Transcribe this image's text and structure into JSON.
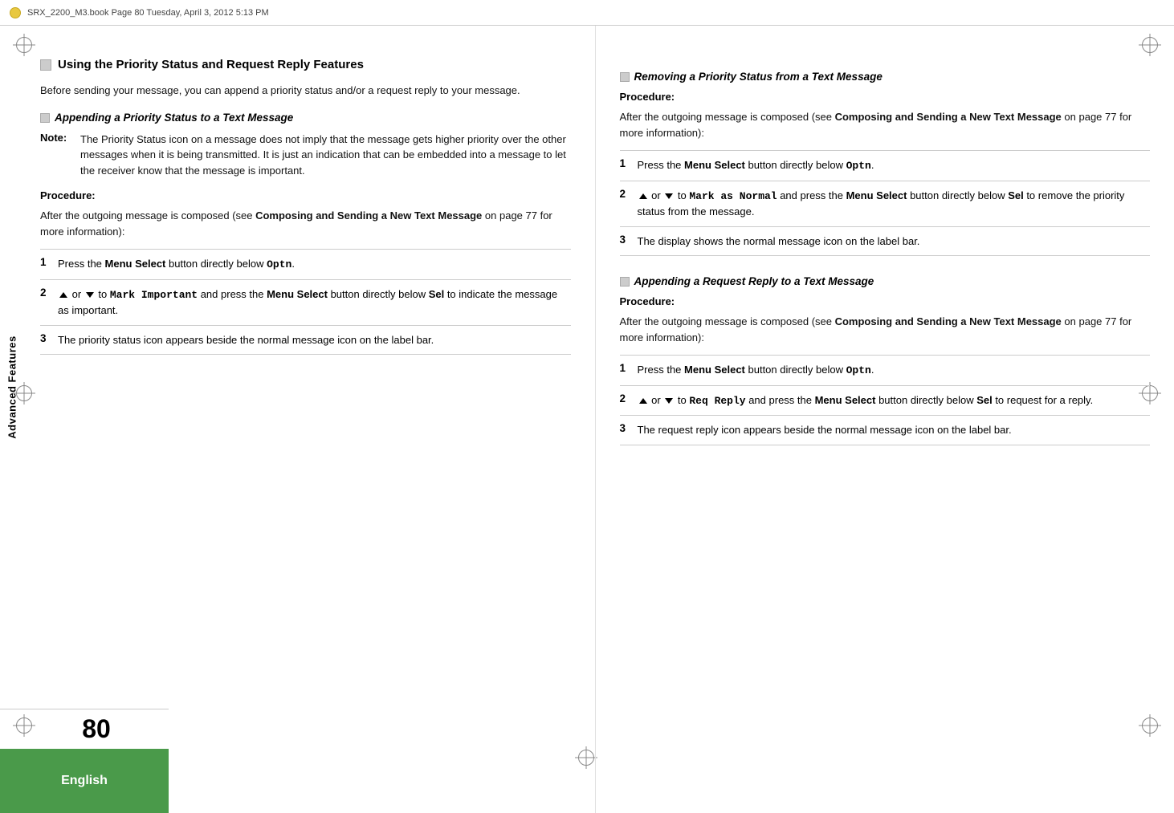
{
  "topbar": {
    "filename": "SRX_2200_M3.book  Page 80  Tuesday, April 3, 2012  5:13 PM"
  },
  "bottom": {
    "language": "English",
    "page_number": "80"
  },
  "sidebar": {
    "label": "Advanced Features"
  },
  "left_col": {
    "main_heading": "Using the Priority Status and Request Reply Features",
    "intro_text": "Before sending your message, you can append a priority status and/or a request reply to your message.",
    "sub_heading": "Appending a Priority Status to a Text Message",
    "note_label": "Note:",
    "note_text": "The Priority Status icon on a message does not imply that the message gets higher priority over the other messages when it is being transmitted. It is just an indication that can be embedded into a message to let the receiver know that the message is important.",
    "procedure_label": "Procedure:",
    "procedure_text": "After the outgoing message is composed (see Composing and Sending a New Text Message on page 77 for more information):",
    "steps": [
      {
        "num": "1",
        "text_before": "Press the ",
        "bold1": "Menu Select",
        "text_mid": " button directly below ",
        "mono1": "Optn",
        "text_after": "."
      },
      {
        "num": "2",
        "text_part1": " or ",
        "text_part2": " to ",
        "mono1": "Mark Important",
        "text_part3": " and press the ",
        "bold1": "Menu Select",
        "text_part4": " button directly below ",
        "bold2": "Sel",
        "text_part5": " to indicate the message as important."
      },
      {
        "num": "3",
        "text": "The priority status icon appears beside the normal message icon on the label bar."
      }
    ]
  },
  "right_col": {
    "section1": {
      "heading": "Removing a Priority Status from a Text Message",
      "procedure_label": "Procedure:",
      "procedure_text": "After the outgoing message is composed (see Composing and Sending a New Text Message on page 77 for more information):",
      "steps": [
        {
          "num": "1",
          "text_before": "Press the ",
          "bold1": "Menu Select",
          "text_mid": " button directly below ",
          "mono1": "Optn",
          "text_after": "."
        },
        {
          "num": "2",
          "text_part1": " or ",
          "text_part2": " to ",
          "mono1": "Mark as Normal",
          "text_part3": " and press the ",
          "bold1": "Menu Select",
          "text_part4": " button directly below ",
          "bold2": "Sel",
          "text_part5": " to remove the priority status from the message."
        },
        {
          "num": "3",
          "text": "The display shows the normal message icon on the label bar."
        }
      ]
    },
    "section2": {
      "heading": "Appending a Request Reply to a Text Message",
      "procedure_label": "Procedure:",
      "procedure_text": "After the outgoing message is composed (see Composing and Sending a New Text Message on page 77 for more information):",
      "steps": [
        {
          "num": "1",
          "text_before": "Press the ",
          "bold1": "Menu Select",
          "text_mid": " button directly below ",
          "mono1": "Optn",
          "text_after": "."
        },
        {
          "num": "2",
          "text_part1": " or ",
          "text_part2": " to ",
          "mono1": "Req Reply",
          "text_part3": " and press the ",
          "bold1": "Menu Select",
          "text_part4": " button directly below ",
          "bold2": "Sel",
          "text_part5": " to request for a reply."
        },
        {
          "num": "3",
          "text": "The request reply icon appears beside the normal message icon on the label bar."
        }
      ]
    }
  }
}
